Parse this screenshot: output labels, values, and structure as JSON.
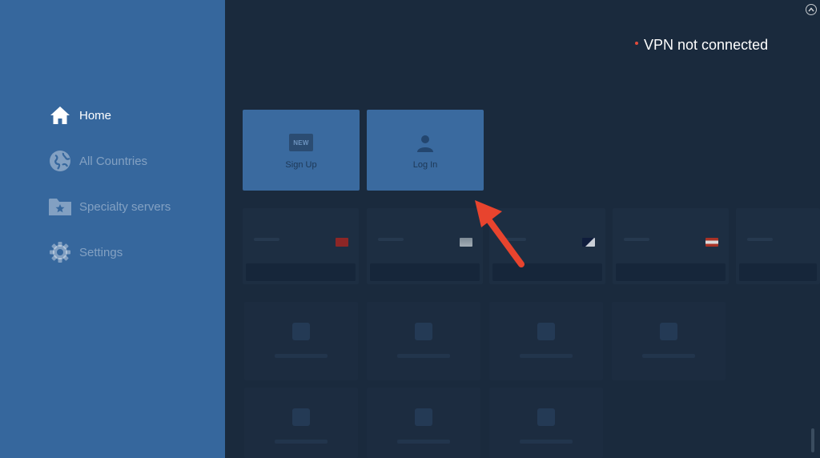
{
  "sidebar": {
    "items": [
      {
        "id": "home",
        "label": "Home",
        "icon": "home-icon",
        "active": true
      },
      {
        "id": "all-countries",
        "label": "All Countries",
        "icon": "globe-icon",
        "active": false
      },
      {
        "id": "specialty-servers",
        "label": "Specialty servers",
        "icon": "star-folder-icon",
        "active": false
      },
      {
        "id": "settings",
        "label": "Settings",
        "icon": "gear-icon",
        "active": false
      }
    ]
  },
  "header": {
    "status_text": "VPN not connected",
    "status_color": "#e34b3b"
  },
  "actions": {
    "signup_label": "Sign Up",
    "signup_badge": "NEW",
    "login_label": "Log In"
  },
  "server_cards": [
    {
      "flag_colors": [
        "#b32b2b",
        "#b32b2b"
      ]
    },
    {
      "flag_colors": [
        "#8a9aa8",
        "#c7d0d7"
      ]
    },
    {
      "flag_colors": [
        "#1c2a55",
        "#ffffff"
      ]
    },
    {
      "flag_colors": [
        "#c0392b",
        "#e6e6e6"
      ]
    },
    {
      "flag_colors": [
        "#1d2e42",
        "#1d2e42"
      ]
    }
  ],
  "colors": {
    "sidebar_bg": "#36679d",
    "main_bg": "#1a2a3d",
    "tile_bg": "#3a6a9f",
    "arrow": "#e8442e"
  }
}
